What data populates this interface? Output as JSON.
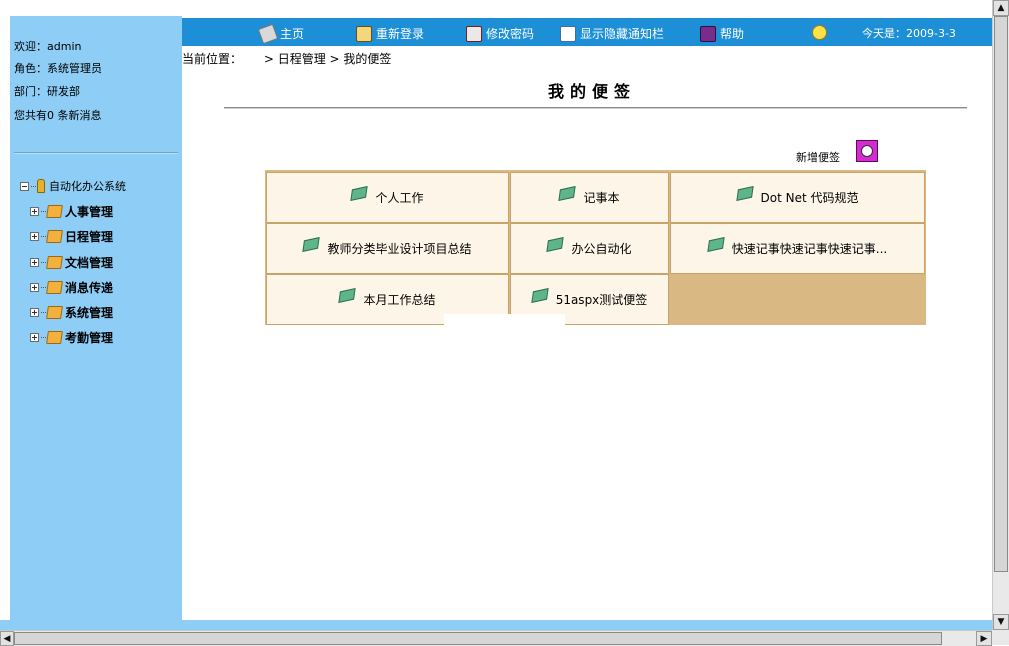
{
  "user": {
    "welcome": "欢迎：admin",
    "role": "角色：系统管理员",
    "dept": "部门：研发部",
    "messages": "您共有0 条新消息"
  },
  "tree": {
    "root": "自动化办公系统",
    "items": [
      "人事管理",
      "日程管理",
      "文档管理",
      "消息传递",
      "系统管理",
      "考勤管理"
    ]
  },
  "toolbar": {
    "home": "主页",
    "relogin": "重新登录",
    "change_password": "修改密码",
    "toggle_notice": "显示隐藏通知栏",
    "help": "帮助",
    "today": "今天是：2009-3-3"
  },
  "breadcrumb": {
    "label": "当前位置：",
    "path": "> 日程管理 > 我的便签"
  },
  "page": {
    "title": "我的便签",
    "add_note": "新增便签"
  },
  "notes": [
    "个人工作",
    "记事本",
    "Dot Net 代码规范",
    "教师分类毕业设计项目总结",
    "办公自动化",
    "快速记事快速记事快速记事...",
    "本月工作总结",
    "51aspx测试便签"
  ],
  "colors": {
    "sidebar": "#8ecdf5",
    "topbar": "#1d8fd6",
    "note_cell": "#fdf6e8",
    "note_grid": "#d9b884"
  }
}
